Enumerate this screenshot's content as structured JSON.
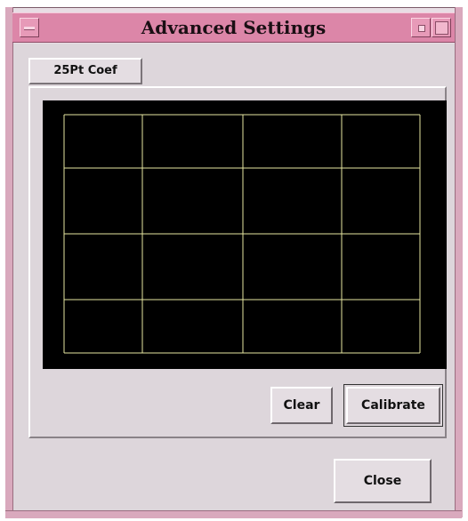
{
  "window": {
    "title": "Advanced Settings"
  },
  "tab": {
    "label": "25Pt Coef"
  },
  "calibration": {
    "background": "#000000",
    "grid_color": "#e6e6a0",
    "grid_columns": 4,
    "grid_rows": 4
  },
  "buttons": {
    "clear": "Clear",
    "calibrate": "Calibrate",
    "close": "Close"
  },
  "colors": {
    "titlebar": "#dc86a8",
    "frame": "#d9a9bd",
    "dialog_bg": "#ddd6db"
  },
  "icons": {
    "window_menu": "window-menu-icon",
    "minimize": "minimize-icon",
    "maximize": "maximize-icon"
  }
}
